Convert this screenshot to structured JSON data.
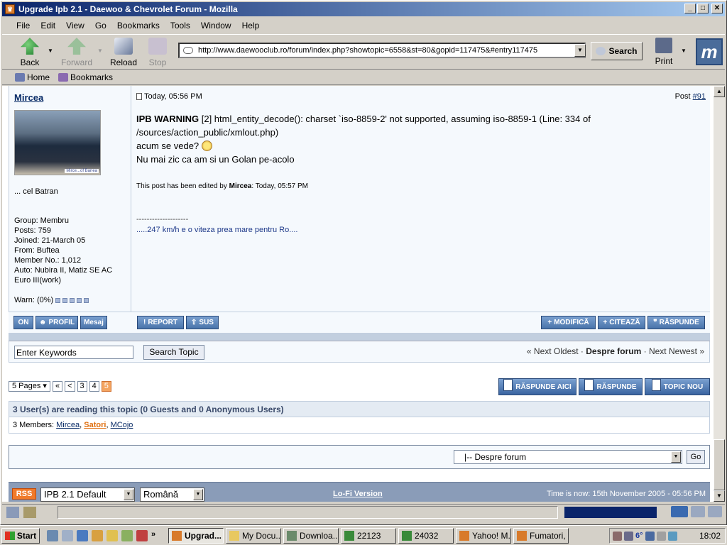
{
  "window": {
    "title": "Upgrade Ipb 2.1 - Daewoo & Chevrolet Forum - Mozilla"
  },
  "menu": [
    "File",
    "Edit",
    "View",
    "Go",
    "Bookmarks",
    "Tools",
    "Window",
    "Help"
  ],
  "nav": {
    "back": "Back",
    "forward": "Forward",
    "reload": "Reload",
    "stop": "Stop",
    "search": "Search",
    "print": "Print"
  },
  "url": "http://www.daewooclub.ro/forum/index.php?showtopic=6558&st=80&gopid=117475&#entry117475",
  "bookmarks": {
    "home": "Home",
    "bookmarks": "Bookmarks"
  },
  "post": {
    "author": "Mircea",
    "avatar_tag": "Mirce...of Banea",
    "author_title": "... cel Batran",
    "meta": [
      "Group: Membru",
      "Posts: 759",
      "Joined: 21-March 05",
      "From: Buftea",
      "Member No.: 1,012",
      "Auto: Nubira II, Matiz SE AC",
      "Euro III(work)"
    ],
    "warn_label": "Warn: (0%)",
    "date": "Today, 05:56 PM",
    "post_label": "Post ",
    "post_num": "#91",
    "warning": "IPB WARNING",
    "warning_text": " [2] html_entity_decode(): charset `iso-8859-2' not supported, assuming iso-8859-1 (Line: 334 of /sources/action_public/xmlout.php)",
    "line1": "acum se vede? ",
    "line2": "Nu mai zic ca am si un Golan pe-acolo",
    "edited_prefix": "This post has been edited by ",
    "edited_by": "Mircea",
    "edited_time": ": Today, 05:57 PM",
    "sig_line": "--------------------",
    "signature": ".....247 km/h e o viteza prea mare pentru Ro....",
    "buttons_left": [
      "ON",
      "PROFIL",
      "Mesaj"
    ],
    "buttons_mid": [
      "REPORT",
      "SUS"
    ],
    "buttons_right": [
      "MODIFICĂ",
      "CITEAZĂ",
      "RĂSPUNDE"
    ]
  },
  "search": {
    "keywords": "Enter Keywords",
    "button": "Search Topic",
    "prev": "« Next Oldest",
    "forum": "Despre forum",
    "next": "Next Newest »"
  },
  "pagination": {
    "pages": "5 Pages",
    "first": "«",
    "prev": "<",
    "p3": "3",
    "p4": "4",
    "p5": "5"
  },
  "reply_buttons": [
    "RĂSPUNDE AICI",
    "RĂSPUNDE",
    "TOPIC NOU"
  ],
  "readers": {
    "header": "3 User(s) are reading this topic (0 Guests and 0 Anonymous Users)",
    "members_label": "3 Members: ",
    "members": [
      "Mircea",
      "Satori",
      "MCojo"
    ]
  },
  "jump": {
    "selected": "|-- Despre forum",
    "go": "Go"
  },
  "footer": {
    "rss": "RSS",
    "skin": "IPB 2.1 Default",
    "lang": "Română",
    "lofi": "Lo-Fi Version",
    "time": "Time is now: 15th November 2005 - 05:56 PM"
  },
  "taskbar": {
    "start": "Start",
    "tasks": [
      "Upgrad...",
      "My Docu...",
      "Downloa...",
      "22123",
      "24032",
      "Yahoo! M...",
      "Fumatori, ..."
    ],
    "clock": "18:02",
    "temp": "6°"
  },
  "colors": {
    "title_bar": "#0a246a",
    "forum_accent": "#4a74aa",
    "current_page": "#f4a460",
    "online_member": "#e07010"
  }
}
